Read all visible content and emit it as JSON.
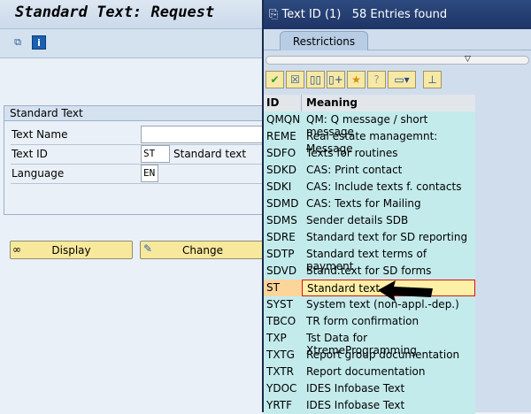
{
  "main": {
    "title": "Standard Text: Request",
    "toolbar": [
      "copy-icon",
      "info-icon"
    ],
    "group_title": "Standard Text",
    "fields": [
      {
        "label": "Text Name",
        "value": ""
      },
      {
        "label": "Text ID",
        "value": "ST",
        "desc": "Standard text"
      },
      {
        "label": "Language",
        "value": "EN"
      }
    ],
    "buttons": {
      "display": "Display",
      "change": "Change"
    }
  },
  "popup": {
    "title": "Text ID (1)   58 Entries found",
    "tab": "Restrictions",
    "toolbar": [
      "check-icon",
      "cancel-icon",
      "find-icon",
      "find-next-icon",
      "favorite-add-icon",
      "help-icon",
      "print-icon",
      "pin-icon"
    ],
    "columns": [
      "ID",
      "Meaning"
    ],
    "rows": [
      [
        "QMQN",
        "QM: Q message / short message"
      ],
      [
        "REME",
        "Real estate managemnt: Message"
      ],
      [
        "SDFO",
        "Texts for routines"
      ],
      [
        "SDKD",
        "CAS: Print contact"
      ],
      [
        "SDKI",
        "CAS: Include texts f. contacts"
      ],
      [
        "SDMD",
        "CAS: Texts for Mailing"
      ],
      [
        "SDMS",
        "Sender details  SDB"
      ],
      [
        "SDRE",
        "Standard text for SD reporting"
      ],
      [
        "SDTP",
        "Standard text terms of payment"
      ],
      [
        "SDVD",
        "Stand.text for SD forms"
      ],
      [
        "ST",
        "Standard text"
      ],
      [
        "SYST",
        "System text (non-appl.-dep.)"
      ],
      [
        "TBCO",
        "TR form confirmation"
      ],
      [
        "TXP",
        "Tst Data for XtremeProgramming"
      ],
      [
        "TXTG",
        "Report group documentation"
      ],
      [
        "TXTR",
        "Report documentation"
      ],
      [
        "YDOC",
        "IDES Infobase Text"
      ],
      [
        "YRTF",
        "IDES Infobase Text"
      ]
    ],
    "selected_index": 10
  }
}
